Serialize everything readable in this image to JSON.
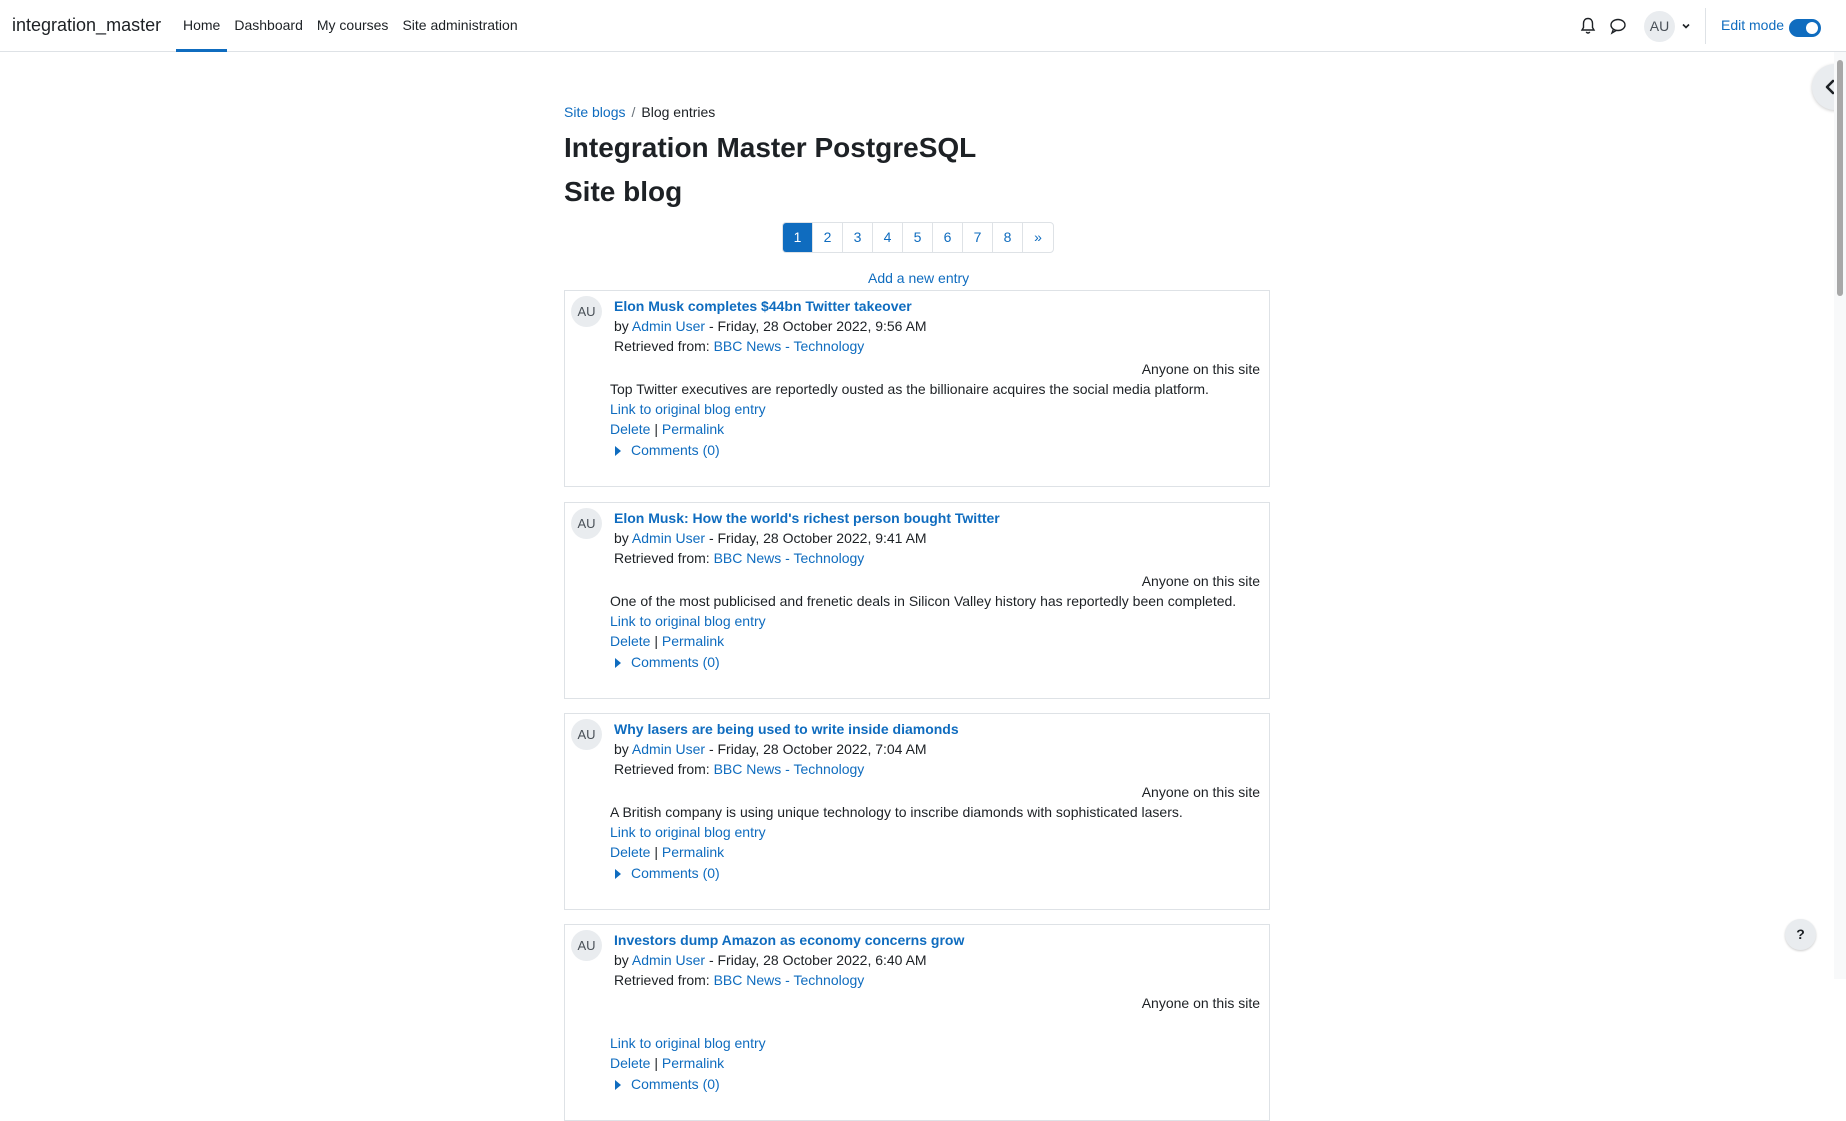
{
  "navbar": {
    "brand": "integration_master",
    "links": [
      "Home",
      "Dashboard",
      "My courses",
      "Site administration"
    ],
    "avatar_initials": "AU",
    "edit_mode_label": "Edit mode"
  },
  "breadcrumb": {
    "parent": "Site blogs",
    "separator": "/",
    "current": "Blog entries"
  },
  "headings": {
    "site_name": "Integration Master PostgreSQL",
    "page_title": "Site blog"
  },
  "pagination": {
    "pages": [
      "1",
      "2",
      "3",
      "4",
      "5",
      "6",
      "7",
      "8",
      "»"
    ],
    "active": "1"
  },
  "add_entry_label": "Add a new entry",
  "entries": [
    {
      "avatar": "AU",
      "title": "Elon Musk completes $44bn Twitter takeover",
      "by": "by",
      "author": "Admin User",
      "date": "- Friday, 28 October 2022, 9:56 AM",
      "retrieved_label": "Retrieved from:",
      "source": "BBC News - Technology",
      "visibility": "Anyone on this site",
      "summary": "Top Twitter executives are reportedly ousted as the billionaire acquires the social media platform.",
      "orig_link": "Link to original blog entry",
      "delete": "Delete",
      "pipe": "|",
      "permalink": "Permalink",
      "comments": "Comments (0)"
    },
    {
      "avatar": "AU",
      "title": "Elon Musk: How the world's richest person bought Twitter",
      "by": "by",
      "author": "Admin User",
      "date": "- Friday, 28 October 2022, 9:41 AM",
      "retrieved_label": "Retrieved from:",
      "source": "BBC News - Technology",
      "visibility": "Anyone on this site",
      "summary": "One of the most publicised and frenetic deals in Silicon Valley history has reportedly been completed.",
      "orig_link": "Link to original blog entry",
      "delete": "Delete",
      "pipe": "|",
      "permalink": "Permalink",
      "comments": "Comments (0)"
    },
    {
      "avatar": "AU",
      "title": "Why lasers are being used to write inside diamonds",
      "by": "by",
      "author": "Admin User",
      "date": "- Friday, 28 October 2022, 7:04 AM",
      "retrieved_label": "Retrieved from:",
      "source": "BBC News - Technology",
      "visibility": "Anyone on this site",
      "summary": "A British company is using unique technology to inscribe diamonds with sophisticated lasers.",
      "orig_link": "Link to original blog entry",
      "delete": "Delete",
      "pipe": "|",
      "permalink": "Permalink",
      "comments": "Comments (0)"
    },
    {
      "avatar": "AU",
      "title": "Investors dump Amazon as economy concerns grow",
      "by": "by",
      "author": "Admin User",
      "date": "- Friday, 28 October 2022, 6:40 AM",
      "retrieved_label": "Retrieved from:",
      "source": "BBC News - Technology",
      "visibility": "Anyone on this site",
      "summary": "",
      "orig_link": "Link to original blog entry",
      "delete": "Delete",
      "pipe": "|",
      "permalink": "Permalink",
      "comments": "Comments (0)"
    }
  ],
  "help_label": "?",
  "colors": {
    "link": "#0f6cbf",
    "text": "#1d2125",
    "border": "#dee2e6"
  }
}
